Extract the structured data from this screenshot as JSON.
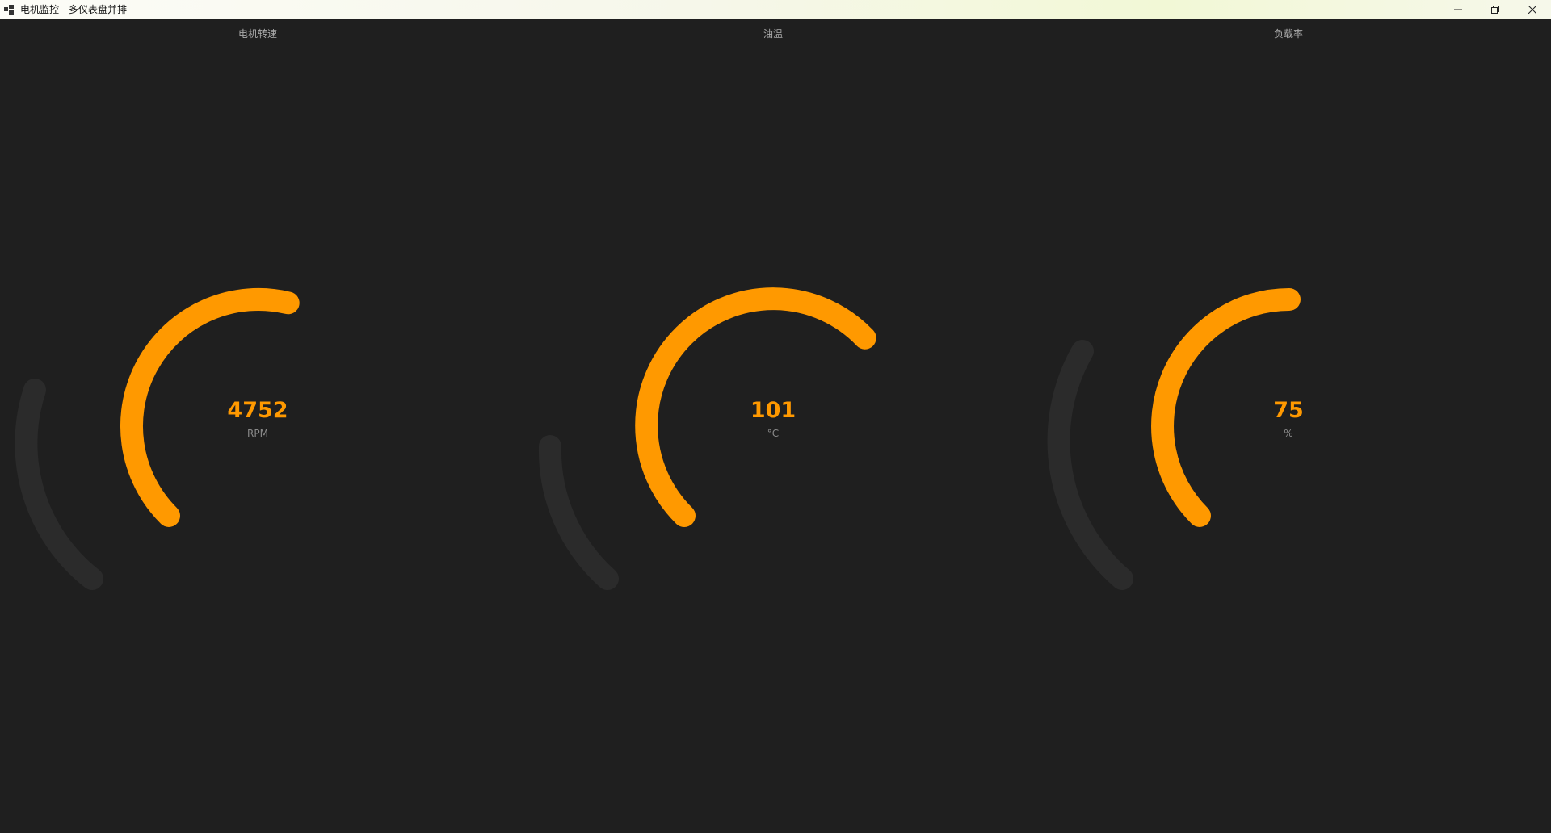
{
  "window": {
    "title": "电机监控 - 多仪表盘并排",
    "controls": [
      "minimize-icon",
      "restore-icon",
      "close-icon"
    ]
  },
  "colors": {
    "background": "#1f1f1f",
    "accent": "#ff9900",
    "track": "#2b2b2b",
    "label": "#aaaaaa",
    "unit": "#8a8a8a"
  },
  "gauges": [
    {
      "label": "电机转速",
      "value": "4752",
      "unit": "RPM",
      "fill_fraction": 0.55
    },
    {
      "label": "油温",
      "value": "101",
      "unit": "°C",
      "fill_fraction": 0.67
    },
    {
      "label": "负载率",
      "value": "75",
      "unit": "%",
      "fill_fraction": 0.5
    }
  ]
}
